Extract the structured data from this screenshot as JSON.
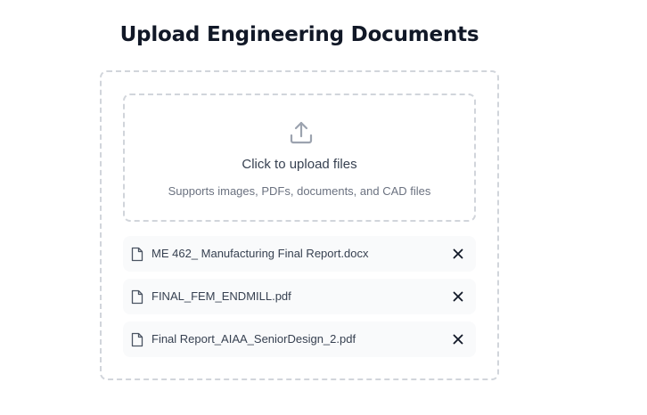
{
  "header": {
    "title": "Upload Engineering Documents"
  },
  "dropzone": {
    "icon": "upload-icon",
    "title": "Click to upload files",
    "subtitle": "Supports images, PDFs, documents, and CAD files"
  },
  "files": [
    {
      "name": "ME 462_ Manufacturing Final Report.docx",
      "icon": "file-icon",
      "remove_icon": "close-icon"
    },
    {
      "name": "FINAL_FEM_ENDMILL.pdf",
      "icon": "file-icon",
      "remove_icon": "close-icon"
    },
    {
      "name": "Final Report_AIAA_SeniorDesign_2.pdf",
      "icon": "file-icon",
      "remove_icon": "close-icon"
    }
  ],
  "colors": {
    "border": "#d1d5db",
    "file_bg": "#f9fafb",
    "icon": "#9ca3af",
    "text": "#374151",
    "muted": "#6b7280"
  }
}
